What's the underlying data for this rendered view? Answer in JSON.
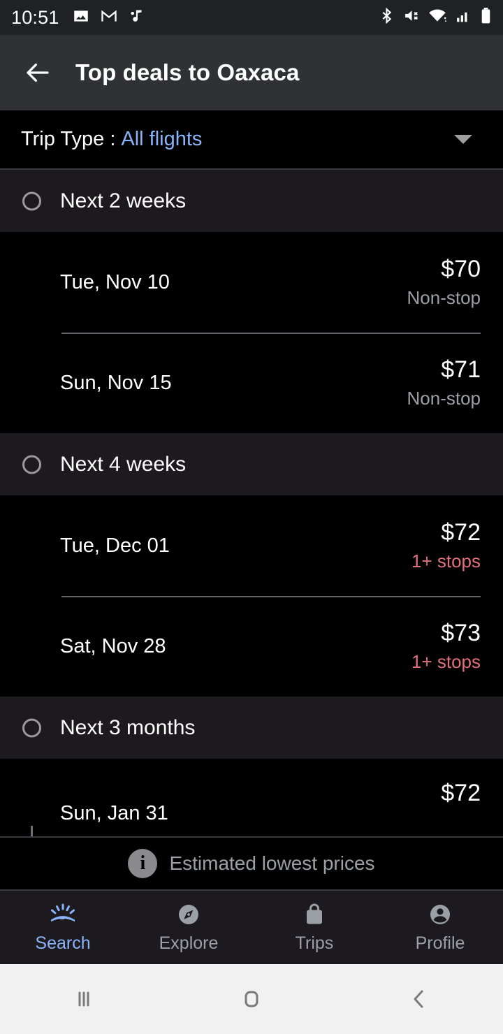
{
  "status_bar": {
    "time": "10:51",
    "left_icons": [
      "image-icon",
      "gmail-icon",
      "music-note-icon"
    ],
    "right_icons": [
      "bluetooth-icon",
      "volume-mute-icon",
      "wifi-icon",
      "cellular-signal-icon",
      "battery-icon"
    ]
  },
  "toolbar": {
    "back_icon": "back-arrow-icon",
    "title": "Top deals to Oaxaca"
  },
  "filter": {
    "label": "Trip Type :",
    "value": "All flights",
    "caret_icon": "chevron-down-icon"
  },
  "sections": [
    {
      "title": "Next 2 weeks",
      "deals": [
        {
          "date": "Tue, Nov 10",
          "price": "$70",
          "stops": "Non-stop",
          "stops_warn": false
        },
        {
          "date": "Sun, Nov 15",
          "price": "$71",
          "stops": "Non-stop",
          "stops_warn": false
        }
      ]
    },
    {
      "title": "Next 4 weeks",
      "deals": [
        {
          "date": "Tue, Dec 01",
          "price": "$72",
          "stops": "1+ stops",
          "stops_warn": true
        },
        {
          "date": "Sat, Nov 28",
          "price": "$73",
          "stops": "1+ stops",
          "stops_warn": true
        }
      ]
    },
    {
      "title": "Next 3 months",
      "deals": [
        {
          "date": "Sun, Jan 31",
          "price": "$72",
          "stops": "",
          "stops_warn": false
        }
      ]
    }
  ],
  "info_footer": {
    "icon": "info-icon",
    "text": "Estimated lowest prices"
  },
  "bottom_nav": {
    "items": [
      {
        "label": "Search",
        "icon": "flight-search-sunrise-icon",
        "active": true
      },
      {
        "label": "Explore",
        "icon": "compass-icon",
        "active": false
      },
      {
        "label": "Trips",
        "icon": "bag-icon",
        "active": false
      },
      {
        "label": "Profile",
        "icon": "person-icon",
        "active": false
      }
    ]
  },
  "android_nav": {
    "recents_icon": "recents-icon",
    "home_icon": "home-icon",
    "back_icon": "back-chevron-icon"
  },
  "colors": {
    "accent_blue": "#8ab4f8",
    "warn_red": "#e0707c",
    "muted_gray": "#9aa0a6",
    "toolbar_bg": "#303134",
    "section_bg": "#1c1a1f",
    "page_bg": "#000000"
  }
}
